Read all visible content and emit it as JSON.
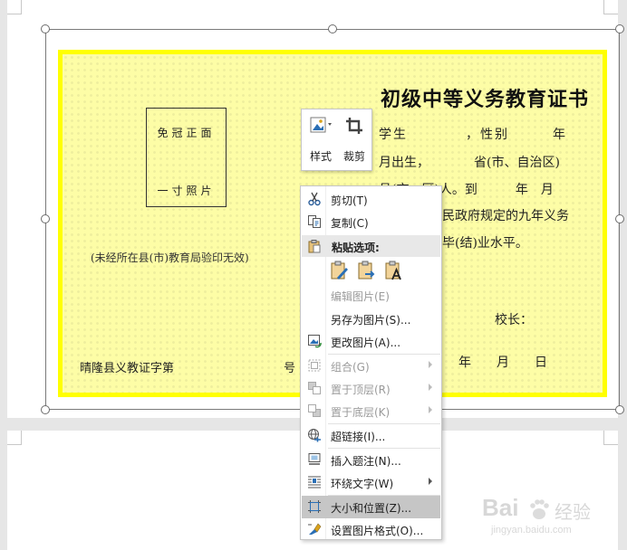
{
  "certificate": {
    "title": "初级中等义务教育证书",
    "line1": "学生　　　　，性别　　　年",
    "line2": "月出生，　　　　省(市、自治区)",
    "line3": "县(市、区)人。到　　　年　月",
    "line4": "民政府规定的九年义务",
    "line5": "毕(结)业水平。",
    "principal": "校长：",
    "date": "年　　月　　日",
    "photo_line1": "免冠正面",
    "photo_line2": "一寸照片",
    "stamp_note": "(未经所在县(市)教育局验印无效)",
    "cert_no_prefix": "晴隆县义教证字第",
    "cert_no_suffix": "号"
  },
  "mini_toolbar": {
    "style_label": "样式",
    "crop_label": "裁剪"
  },
  "context_menu": {
    "cut": "剪切(T)",
    "copy": "复制(C)",
    "paste_options": "粘贴选项:",
    "edit_picture": "编辑图片(E)",
    "save_as_picture": "另存为图片(S)...",
    "change_picture": "更改图片(A)...",
    "group": "组合(G)",
    "bring_to_front": "置于顶层(R)",
    "send_to_back": "置于底层(K)",
    "hyperlink": "超链接(I)...",
    "insert_caption": "插入题注(N)...",
    "wrap_text": "环绕文字(W)",
    "size_and_position": "大小和位置(Z)...",
    "format_picture": "设置图片格式(O)..."
  },
  "watermark": {
    "brand": "Bai",
    "brand_suffix": "经验",
    "url": "jingyan.baidu.com"
  },
  "colors": {
    "certificate_fill": "#fdfda6",
    "certificate_border": "#ffff00",
    "menu_highlight": "#c6c6c6",
    "icon_blue": "#2a6fb5",
    "icon_gold": "#d9a21b"
  }
}
